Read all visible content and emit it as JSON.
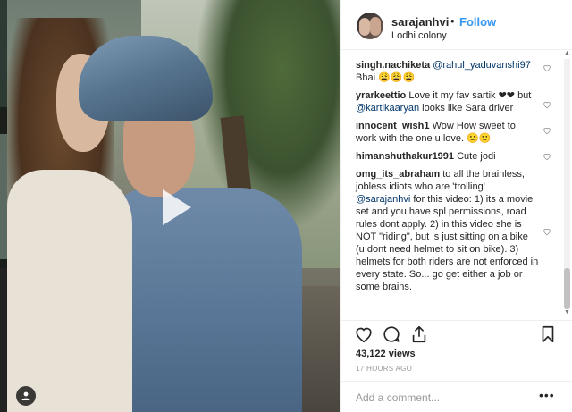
{
  "post": {
    "username": "sarajanhvi",
    "separator": "•",
    "follow_label": "Follow",
    "location": "Lodhi colony"
  },
  "comments": [
    {
      "user": "singh.nachiketa",
      "mention": "@rahul_yaduvanshi97",
      "text": "Bhai 😩😩😩"
    },
    {
      "user": "yrarkeettio",
      "text_before": "Love it my fav sartik ❤❤ but",
      "mention": "@kartikaaryan",
      "text_after": "looks like Sara driver"
    },
    {
      "user": "innocent_wish1",
      "text": "Wow How sweet to work with the one u love. 🙂🙂"
    },
    {
      "user": "himanshuthakur1991",
      "text": "Cute jodi"
    },
    {
      "user": "omg_its_abraham",
      "text_before": "to all the brainless, jobless idiots who are 'trolling'",
      "mention": "@sarajanhvi",
      "text_after": "for this video: 1) its a movie set and you have spl permissions, road rules dont apply. 2) in this video she is NOT \"riding\", but is just sitting on a bike (u dont need helmet to sit on bike). 3) helmets for both riders are not enforced in every state. So... go get either a job or some brains."
    }
  ],
  "stats": {
    "views": "43,122 views",
    "time_ago": "17 HOURS AGO"
  },
  "add_comment": {
    "placeholder": "Add a comment...",
    "more": "•••"
  },
  "icons": {
    "play": "play-icon",
    "user_badge": "user-tag-icon",
    "like": "heart-icon",
    "comment": "comment-icon",
    "share": "share-icon",
    "save": "bookmark-icon"
  },
  "colors": {
    "link_blue": "#3897f0",
    "mention_blue": "#003569",
    "text": "#262626",
    "muted": "#999999"
  }
}
